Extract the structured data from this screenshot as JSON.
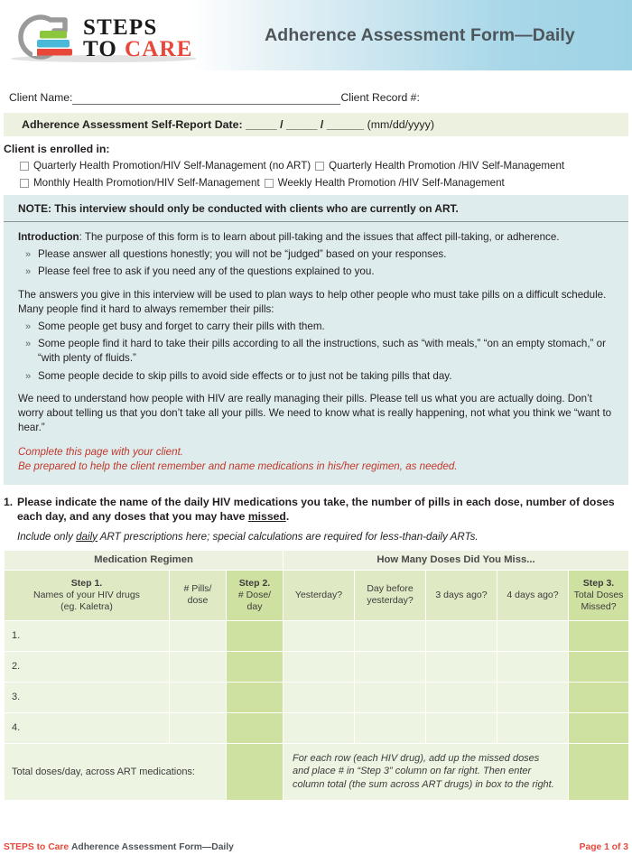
{
  "header": {
    "title": "Adherence Assessment Form—Daily",
    "logo": {
      "line1": "STEPS",
      "line2_a": "TO",
      "line2_b": "CARE",
      "bar_colors": [
        "#8cc63f",
        "#4ab8d8",
        "#e8483a"
      ],
      "ring_color": "#9a9a9a"
    },
    "gradient_from": "#ffffff",
    "gradient_to": "#9ed3e6",
    "title_color": "#4d555a"
  },
  "client": {
    "name_label": "Client Name:",
    "record_label": "Client Record #:",
    "name_value": "",
    "record_value": ""
  },
  "date_bar": {
    "label": "Adherence Assessment Self-Report Date:",
    "blank_mm": "_____",
    "sep1": "/",
    "blank_dd": "_____",
    "sep2": "/",
    "blank_yyyy": "______",
    "format_hint": "(mm/dd/yyyy)",
    "background": "#edf1e0"
  },
  "enrollment": {
    "title": "Client is enrolled in:",
    "rows": [
      {
        "left": "Quarterly Health Promotion/HIV Self-Management (no ART)",
        "right": "Quarterly Health Promotion /HIV Self-Management"
      },
      {
        "left": "Monthly Health Promotion/HIV Self-Management",
        "right": "Weekly Health Promotion /HIV Self-Management"
      }
    ]
  },
  "note": {
    "text": "NOTE: This interview should only be conducted with clients who are currently on ART.",
    "background": "#dfeced"
  },
  "introduction": {
    "label": "Introduction",
    "lead": ": The purpose of this form is to learn about pill-taking and the issues that affect pill-taking, or adherence.",
    "bullets_1": [
      "Please answer all questions honestly; you will not be “judged” based on your responses.",
      "Please feel free to ask if you need any of the questions explained to you."
    ],
    "paragraph_2": "The answers you give in this interview will be used to plan ways to help other people who must take pills on a difficult schedule. Many people find it hard to always remember their pills:",
    "bullets_2": [
      "Some people get busy and forget to carry their pills with them.",
      "Some people find it hard to take their pills according to all the instructions, such as “with meals,” “on an empty stomach,” or “with plenty of fluids.”",
      "Some people decide to skip pills to avoid side effects or to just not be taking pills that day."
    ],
    "paragraph_3": "We need to understand how people with HIV are really managing their pills. Please tell us what you are actually doing. Don’t worry about telling us that you don’t take all your pills. We need to know what is really happening, not what you think we “want to hear.”",
    "red_note_line1": "Complete this page with your client.",
    "red_note_line2": "Be prepared to help the client remember and name medications in his/her regimen, as needed.",
    "red_color": "#c0392b",
    "bullet_glyph": "»"
  },
  "question_1": {
    "number": "1.",
    "text_part1": "Please indicate the name of the daily HIV medications you take, the number of pills in each dose, number of doses each day, and any doses that you may have ",
    "underlined": "missed",
    "text_part2": ".",
    "sub_part1": "Include only ",
    "sub_underlined": "daily",
    "sub_part2": " ART prescriptions here; special calculations are required for less-than-daily ARTs."
  },
  "table": {
    "band_left": "Medication Regimen",
    "band_right": "How Many Doses Did You Miss...",
    "columns": [
      {
        "step": "Step 1.",
        "line1": "Names of your HIV drugs",
        "line2": "(eg. Kaletra)",
        "shade": "light"
      },
      {
        "step": "",
        "line1": "# Pills/",
        "line2": "dose",
        "shade": "light"
      },
      {
        "step": "Step 2.",
        "line1": "# Dose/",
        "line2": "day",
        "shade": "dark"
      },
      {
        "step": "",
        "line1": "Yesterday?",
        "line2": "",
        "shade": "light"
      },
      {
        "step": "",
        "line1": "Day before",
        "line2": "yesterday?",
        "shade": "light"
      },
      {
        "step": "",
        "line1": "3 days ago?",
        "line2": "",
        "shade": "light"
      },
      {
        "step": "",
        "line1": "4 days ago?",
        "line2": "",
        "shade": "light"
      },
      {
        "step": "Step 3.",
        "line1": "Total Doses",
        "line2": "Missed?",
        "shade": "dark"
      }
    ],
    "rows": [
      {
        "index": "1.",
        "drug": "",
        "pills": "",
        "doses": "",
        "yesterday": "",
        "day_before": "",
        "three_days": "",
        "four_days": "",
        "total": ""
      },
      {
        "index": "2.",
        "drug": "",
        "pills": "",
        "doses": "",
        "yesterday": "",
        "day_before": "",
        "three_days": "",
        "four_days": "",
        "total": ""
      },
      {
        "index": "3.",
        "drug": "",
        "pills": "",
        "doses": "",
        "yesterday": "",
        "day_before": "",
        "three_days": "",
        "four_days": "",
        "total": ""
      },
      {
        "index": "4.",
        "drug": "",
        "pills": "",
        "doses": "",
        "yesterday": "",
        "day_before": "",
        "three_days": "",
        "four_days": "",
        "total": ""
      }
    ],
    "total_row": {
      "label": "Total doses/day, across ART medications:",
      "note_line1": "For each row (each HIV drug), add up the missed doses",
      "note_line2": "and place # in “Step 3” column on far right. Then enter",
      "note_line3": "column total (the sum across ART drugs) in box to the right.",
      "doses_value": "",
      "total_value": ""
    },
    "colors": {
      "band": "#edf1e0",
      "header_light": "#dfeac4",
      "header_dark": "#cfe1a0",
      "row_odd": "#edf4e2",
      "row_even": "#e0ecc6",
      "step_column": "#cfe1a0"
    }
  },
  "footer": {
    "brand": "STEPS to Care",
    "doc_title": "Adherence Assessment Form—Daily",
    "page": "Page 1 of 3",
    "brand_color": "#e8483a"
  }
}
